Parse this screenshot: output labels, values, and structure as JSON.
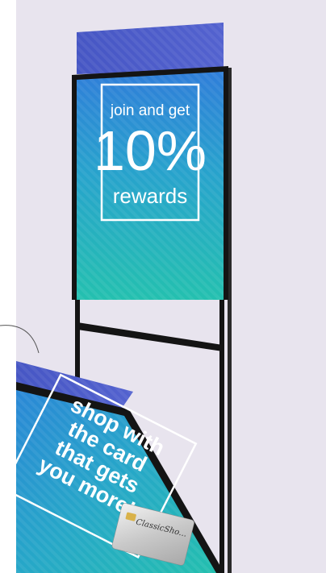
{
  "poster_back": {
    "line1": "join and get",
    "big": "10%",
    "line3": "rewards"
  },
  "poster_front": {
    "line1": "shop with",
    "line2": "the card",
    "line3": "that gets",
    "line4": "you more!",
    "card_text": "ClassicSho..."
  },
  "colors": {
    "background": "#e8e4ee",
    "header_blue": "#4a5fc9",
    "gradient_top": "#2a8fd8",
    "gradient_bottom": "#22bfb0",
    "frame": "#141414",
    "text_white": "#ffffff"
  }
}
